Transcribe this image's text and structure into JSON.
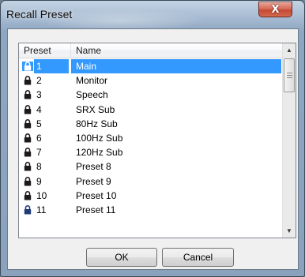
{
  "window": {
    "title": "Recall Preset",
    "close_glyph": "X"
  },
  "list": {
    "columns": [
      "Preset",
      "Name"
    ],
    "selected_index": 0,
    "rows": [
      {
        "number": "1",
        "name": "Main",
        "icon": "lock-icon"
      },
      {
        "number": "2",
        "name": "Monitor",
        "icon": "lock-icon"
      },
      {
        "number": "3",
        "name": "Speech",
        "icon": "lock-icon"
      },
      {
        "number": "4",
        "name": "SRX Sub",
        "icon": "lock-icon"
      },
      {
        "number": "5",
        "name": "80Hz Sub",
        "icon": "lock-icon"
      },
      {
        "number": "6",
        "name": "100Hz Sub",
        "icon": "lock-icon"
      },
      {
        "number": "7",
        "name": "120Hz Sub",
        "icon": "lock-icon"
      },
      {
        "number": "8",
        "name": "Preset 8",
        "icon": "lock-icon"
      },
      {
        "number": "9",
        "name": "Preset 9",
        "icon": "lock-icon"
      },
      {
        "number": "10",
        "name": "Preset 10",
        "icon": "lock-icon"
      },
      {
        "number": "11",
        "name": "Preset 11",
        "icon": "lock-icon"
      }
    ]
  },
  "buttons": {
    "ok": "OK",
    "cancel": "Cancel"
  },
  "scrollbar": {
    "up_glyph": "▲",
    "down_glyph": "▼"
  },
  "colors": {
    "selection": "#3399ff",
    "close_button": "#c44a34"
  }
}
